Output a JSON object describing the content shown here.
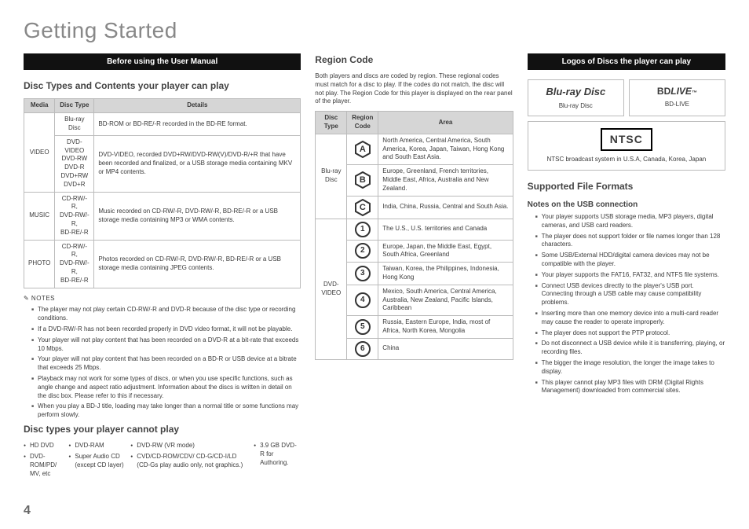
{
  "pageTitle": "Getting Started",
  "pageNumber": "4",
  "banner1": "Before using the User Manual",
  "col1": {
    "h1": "Disc Types and Contents your player can play",
    "table": {
      "headers": [
        "Media",
        "Disc Type",
        "Details"
      ],
      "rows": [
        {
          "media": "VIDEO",
          "types": "Blu-ray Disc",
          "details": "BD-ROM or BD-RE/-R recorded in the BD-RE format.",
          "span": 1
        },
        {
          "media": "",
          "types": "DVD-VIDEO\nDVD-RW\nDVD-R\nDVD+RW\nDVD+R",
          "details": "DVD-VIDEO, recorded DVD+RW/DVD-RW(V)/DVD-R/+R that have been recorded and finalized, or a USB storage media containing MKV or MP4 contents.",
          "span": 1
        },
        {
          "media": "MUSIC",
          "types": "CD-RW/-R,\nDVD-RW/-R,\nBD-RE/-R",
          "details": "Music recorded on CD-RW/-R, DVD-RW/-R, BD-RE/-R or a USB storage media containing MP3 or WMA contents.",
          "span": 1
        },
        {
          "media": "PHOTO",
          "types": "CD-RW/-R,\nDVD-RW/-R,\nBD-RE/-R",
          "details": "Photos recorded on CD-RW/-R, DVD-RW/-R, BD-RE/-R or a USB storage media containing JPEG contents.",
          "span": 1
        }
      ]
    },
    "notesLabel": "✎ NOTES",
    "notes": [
      "The player may not play certain CD-RW/-R and DVD-R because of the disc type or recording conditions.",
      "If a DVD-RW/-R has not been recorded properly in DVD video format, it will not be playable.",
      "Your player will not play content that has been recorded on a DVD-R at a bit-rate that exceeds 10 Mbps.",
      "Your player will not play content that has been recorded on a BD-R or USB device at a bitrate that exceeds 25 Mbps.",
      "Playback may not work for some types of discs, or when you use specific functions, such as angle change and aspect ratio adjustment. Information about the discs is written in detail on the disc box. Please refer to this if necessary.",
      "When you play a BD-J title, loading may take longer than a normal title or some functions may perform slowly."
    ],
    "h2": "Disc types your player cannot play",
    "cannot": [
      [
        "HD DVD",
        "DVD-ROM/PD/ MV, etc"
      ],
      [
        "DVD-RAM",
        "Super Audio CD (except CD layer)"
      ],
      [
        "DVD-RW (VR mode)",
        "CVD/CD-ROM/CDV/ CD-G/CD-I/LD (CD-Gs play audio only, not graphics.)"
      ],
      [
        "3.9 GB DVD-R for Authoring."
      ]
    ]
  },
  "col2": {
    "h1": "Region Code",
    "intro": "Both players and discs are coded by region. These regional codes must match for a disc to play. If the codes do not match, the disc will not play. The Region Code for this player is displayed on the rear panel of the player.",
    "table": {
      "headers": [
        "Disc Type",
        "Region Code",
        "Area"
      ],
      "groups": [
        {
          "type": "Blu-ray Disc",
          "rows": [
            {
              "icon": "A",
              "shape": "hex",
              "area": "North America, Central America, South America, Korea, Japan, Taiwan, Hong Kong and South East Asia."
            },
            {
              "icon": "B",
              "shape": "hex",
              "area": "Europe, Greenland, French territories, Middle East, Africa, Australia and New Zealand."
            },
            {
              "icon": "C",
              "shape": "hex",
              "area": "India, China, Russia, Central and South Asia."
            }
          ]
        },
        {
          "type": "DVD-VIDEO",
          "rows": [
            {
              "icon": "1",
              "shape": "circ",
              "area": "The U.S., U.S. territories and Canada"
            },
            {
              "icon": "2",
              "shape": "circ",
              "area": "Europe, Japan, the Middle East, Egypt, South Africa, Greenland"
            },
            {
              "icon": "3",
              "shape": "circ",
              "area": "Taiwan, Korea, the Philippines, Indonesia, Hong Kong"
            },
            {
              "icon": "4",
              "shape": "circ",
              "area": "Mexico, South America, Central America, Australia, New Zealand, Pacific Islands, Caribbean"
            },
            {
              "icon": "5",
              "shape": "circ",
              "area": "Russia, Eastern Europe, India, most of Africa, North Korea, Mongolia"
            },
            {
              "icon": "6",
              "shape": "circ",
              "area": "China"
            }
          ]
        }
      ]
    }
  },
  "col3": {
    "banner": "Logos of Discs the player can play",
    "logos": [
      {
        "big": "Blu-ray Disc",
        "label": "Blu-ray Disc",
        "style": "bd"
      },
      {
        "big": "BD LIVE™",
        "label": "BD-LIVE",
        "style": "live"
      }
    ],
    "ntsc": {
      "title": "NTSC",
      "caption": "NTSC broadcast system in U.S.A, Canada, Korea, Japan"
    },
    "h1": "Supported File Formats",
    "h2": "Notes on the USB connection",
    "notes": [
      "Your player supports USB storage media, MP3 players, digital cameras, and USB card readers.",
      "The player does not support folder or file names longer than 128 characters.",
      "Some USB/External HDD/digital camera devices may not be compatible with the player.",
      "Your player supports the FAT16, FAT32, and NTFS file systems.",
      "Connect USB devices directly to the player's USB port. Connecting through a USB cable may cause compatibility problems.",
      "Inserting more than one memory device into a multi-card reader may cause the reader to operate improperly.",
      "The player does not support the PTP protocol.",
      "Do not disconnect a USB device while it is transferring, playing, or recording files.",
      "The bigger the image resolution, the longer the image takes to display.",
      "This player cannot play MP3 files with DRM (Digital Rights Management) downloaded from commercial sites."
    ]
  }
}
